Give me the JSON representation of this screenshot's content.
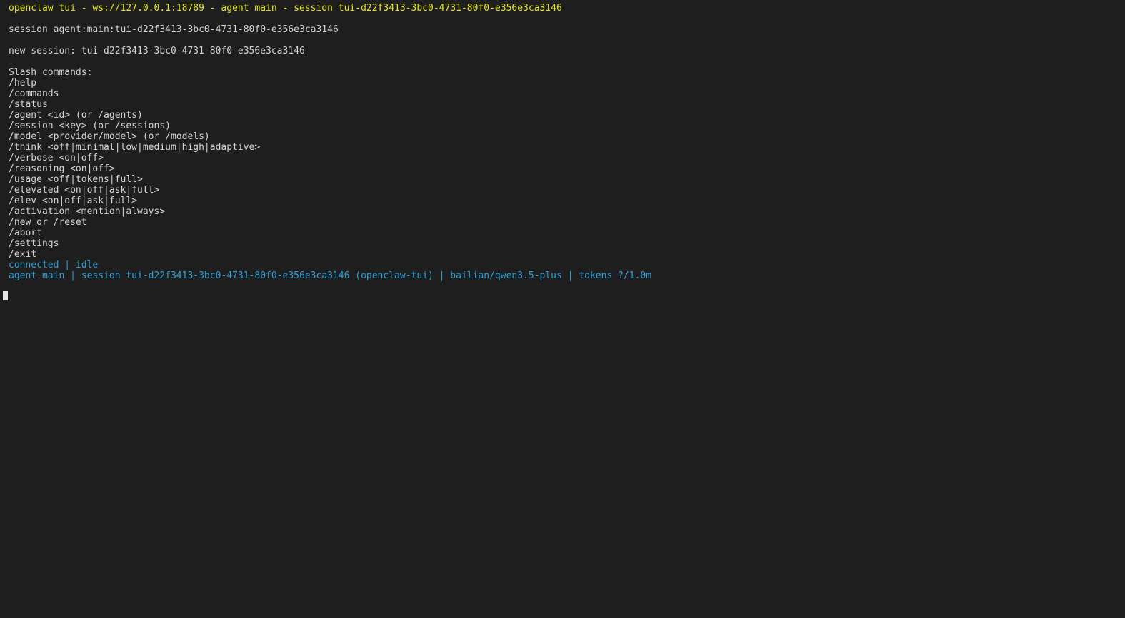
{
  "colors": {
    "background": "#1e1e1e",
    "text": "#d4d4d4",
    "title": "#e5e510",
    "status": "#2b9fd6"
  },
  "terminal": {
    "title": "openclaw tui - ws://127.0.0.1:18789 - agent main - session tui-d22f3413-3bc0-4731-80f0-e356e3ca3146",
    "session_line": "session agent:main:tui-d22f3413-3bc0-4731-80f0-e356e3ca3146",
    "new_session_line": "new session: tui-d22f3413-3bc0-4731-80f0-e356e3ca3146",
    "slash_header": "Slash commands:",
    "commands": [
      "/help",
      "/commands",
      "/status",
      "/agent <id> (or /agents)",
      "/session <key> (or /sessions)",
      "/model <provider/model> (or /models)",
      "/think <off|minimal|low|medium|high|adaptive>",
      "/verbose <on|off>",
      "/reasoning <on|off>",
      "/usage <off|tokens|full>",
      "/elevated <on|off|ask|full>",
      "/elev <on|off|ask|full>",
      "/activation <mention|always>",
      "/new or /reset",
      "/abort",
      "/settings",
      "/exit"
    ],
    "status_line": "connected | idle",
    "footer_line": "agent main | session tui-d22f3413-3bc0-4731-80f0-e356e3ca3146 (openclaw-tui) | bailian/qwen3.5-plus | tokens ?/1.0m"
  }
}
